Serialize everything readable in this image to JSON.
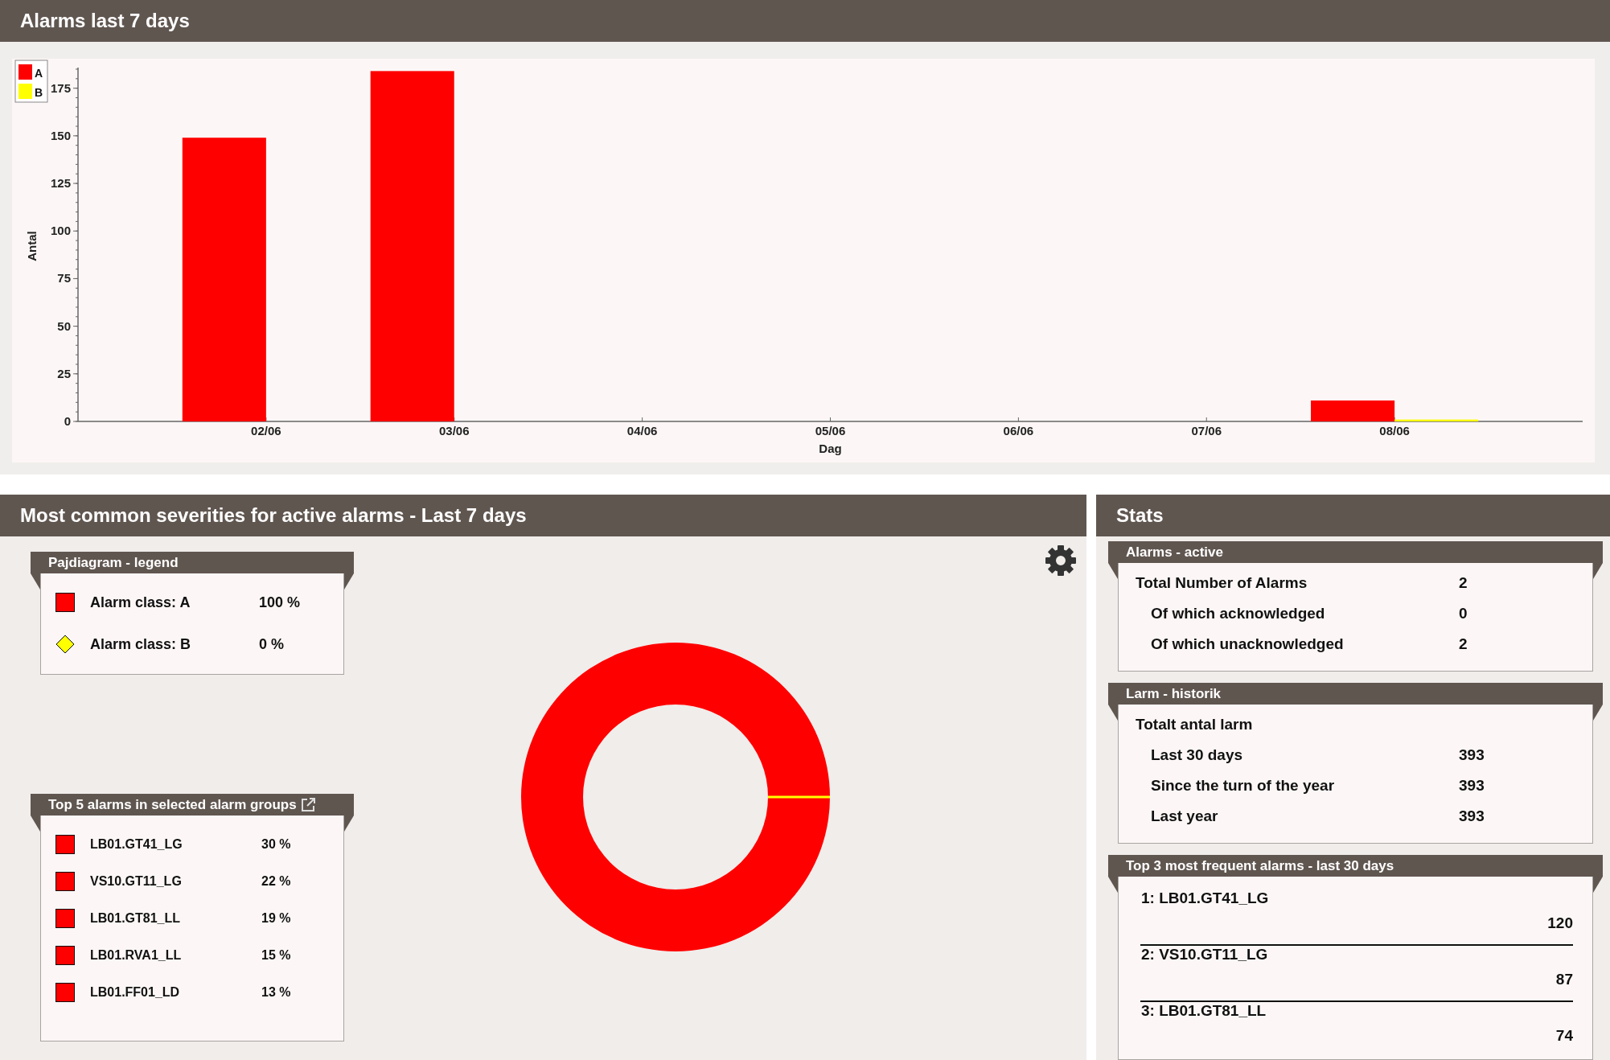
{
  "alarms_panel": {
    "title": "Alarms last 7 days",
    "chart_data": {
      "type": "bar",
      "xlabel": "Dag",
      "ylabel": "Antal",
      "categories": [
        "02/06",
        "03/06",
        "04/06",
        "05/06",
        "06/06",
        "07/06",
        "08/06"
      ],
      "series": [
        {
          "name": "A",
          "color": "#ff0000",
          "values": [
            149,
            184,
            0,
            0,
            0,
            0,
            11
          ]
        },
        {
          "name": "B",
          "color": "#ffff00",
          "values": [
            0,
            0,
            0,
            0,
            0,
            0,
            1
          ]
        }
      ],
      "ylim": [
        0,
        185
      ],
      "yticks": [
        0,
        25,
        50,
        75,
        100,
        125,
        150,
        175
      ],
      "legend": "top-left"
    }
  },
  "severities_panel": {
    "title": "Most common severities for active alarms - Last 7 days",
    "legend": {
      "title": "Pajdiagram - legend",
      "items": [
        {
          "kind": "square",
          "color": "#ff0000",
          "label": "Alarm class: A",
          "percent": "100 %"
        },
        {
          "kind": "diamond",
          "color": "#ffff00",
          "label": "Alarm class: B",
          "percent": "0 %"
        }
      ]
    },
    "top_alarms": {
      "title": "Top 5 alarms in selected alarm groups",
      "items": [
        {
          "color": "#ff0000",
          "name": "LB01.GT41_LG",
          "percent": "30 %"
        },
        {
          "color": "#ff0000",
          "name": "VS10.GT11_LG",
          "percent": "22 %"
        },
        {
          "color": "#ff0000",
          "name": "LB01.GT81_LL",
          "percent": "19 %"
        },
        {
          "color": "#ff0000",
          "name": "LB01.RVA1_LL",
          "percent": "15 %"
        },
        {
          "color": "#ff0000",
          "name": "LB01.FF01_LD",
          "percent": "13 %"
        }
      ]
    },
    "chart_data": {
      "type": "pie",
      "values": [
        100,
        0
      ]
    }
  },
  "stats_panel": {
    "title": "Stats",
    "sections": [
      {
        "title": "Alarms - active",
        "rows": [
          {
            "label": "Total Number of Alarms",
            "value": "2",
            "children": [
              {
                "label": "Of which acknowledged",
                "value": "0"
              },
              {
                "label": "Of which unacknowledged",
                "value": "2"
              }
            ]
          }
        ]
      },
      {
        "title": "Larm - historik",
        "rows": [
          {
            "label": "Totalt antal larm",
            "children": [
              {
                "label": "Last 30 days",
                "value": "393"
              },
              {
                "label": "Since the turn of the year",
                "value": "393"
              },
              {
                "label": "Last year",
                "value": "393"
              }
            ]
          }
        ]
      }
    ],
    "top_frequent": {
      "title": "Top 3 most frequent alarms - last 30 days",
      "items": [
        {
          "name": "1: LB01.GT41_LG",
          "count": "120"
        },
        {
          "name": "2: VS10.GT11_LG",
          "count": "87"
        },
        {
          "name": "3: LB01.GT81_LL",
          "count": "74"
        }
      ]
    }
  }
}
